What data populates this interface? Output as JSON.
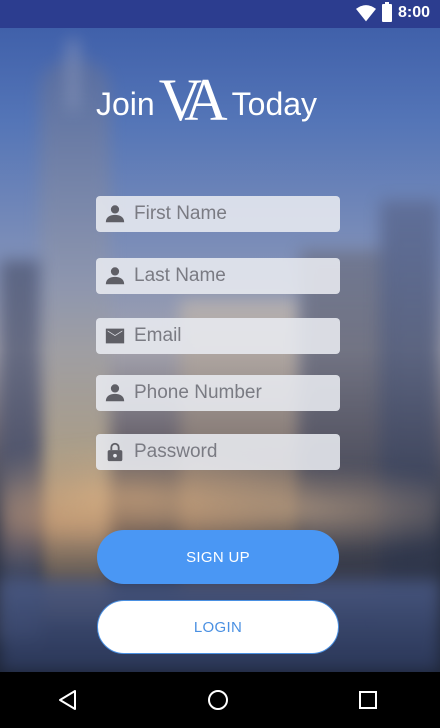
{
  "status_bar": {
    "time": "8:00"
  },
  "logo": {
    "word_left": "Join",
    "mark": "VA",
    "word_right": "Today"
  },
  "form": {
    "first_name": {
      "placeholder": "First Name",
      "value": ""
    },
    "last_name": {
      "placeholder": "Last Name",
      "value": ""
    },
    "email": {
      "placeholder": "Email",
      "value": ""
    },
    "phone": {
      "placeholder": "Phone Number",
      "value": ""
    },
    "password": {
      "placeholder": "Password",
      "value": ""
    }
  },
  "buttons": {
    "signup_label": "SIGN UP",
    "login_label": "LOGIN"
  },
  "icons": {
    "first_name": "person-icon",
    "last_name": "person-icon",
    "email": "mail-icon",
    "phone": "person-icon",
    "password": "lock-icon",
    "nav_back": "back-triangle-icon",
    "nav_home": "home-circle-icon",
    "nav_recent": "recent-square-icon"
  },
  "colors": {
    "status_bar": "#2c3d8f",
    "accent": "#4a97f4",
    "login_text": "#4a90e2",
    "field_bg": "#e8eaf0"
  }
}
